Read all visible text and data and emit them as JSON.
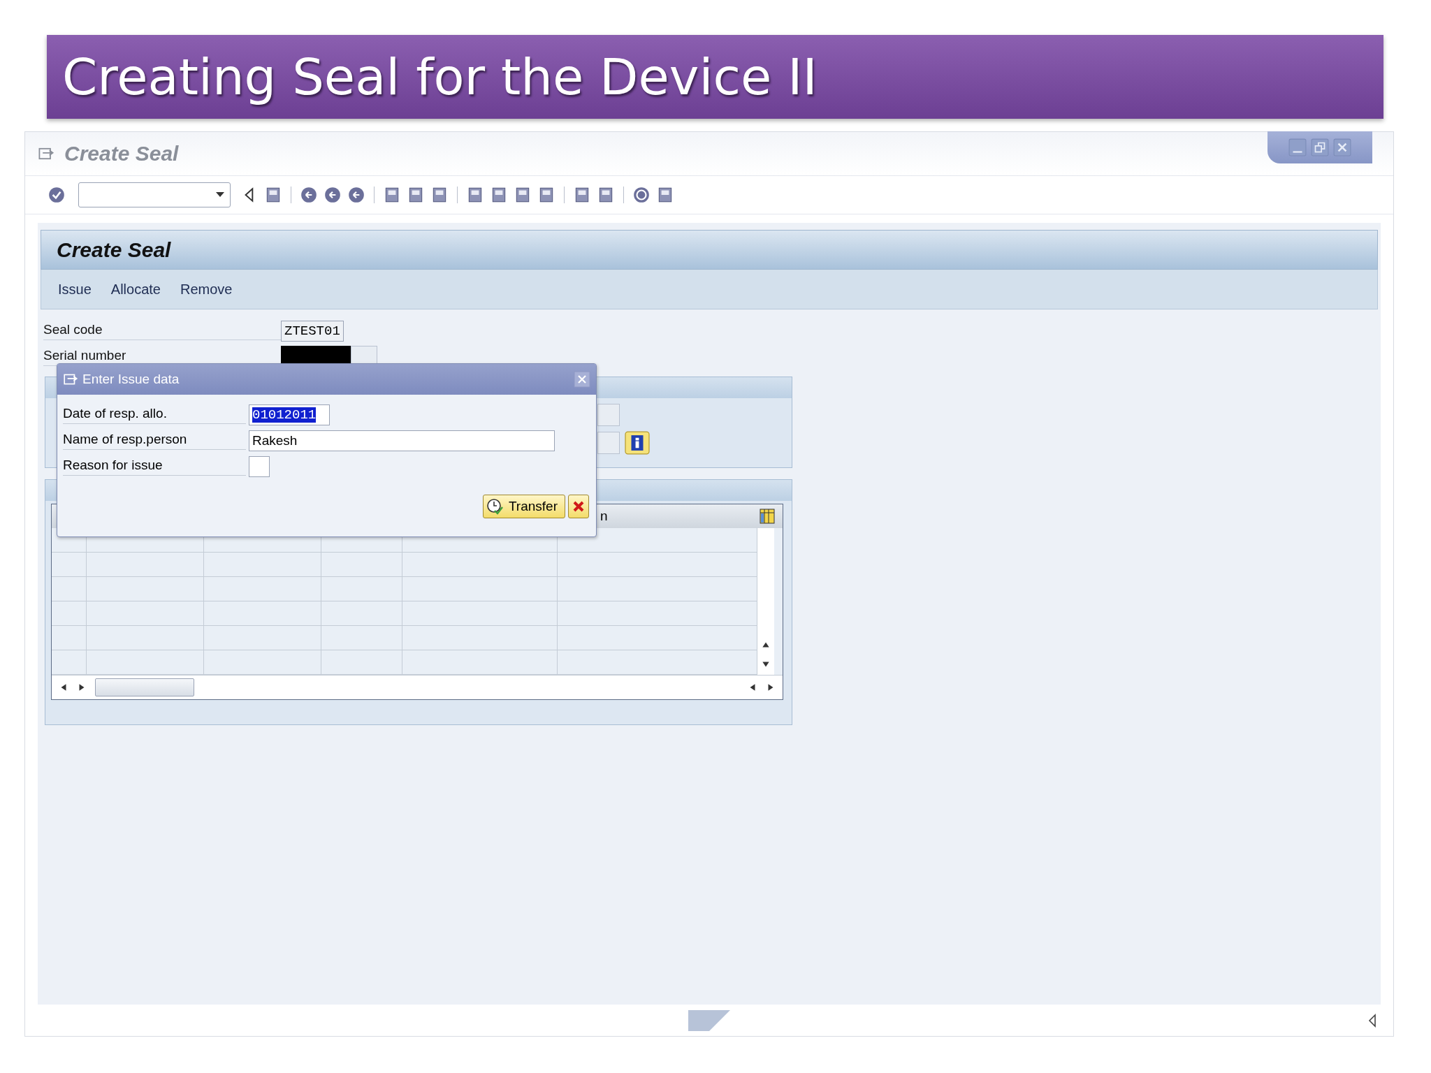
{
  "slide": {
    "title": "Creating Seal for the Device II"
  },
  "window": {
    "title": "Create Seal"
  },
  "screen": {
    "title": "Create Seal",
    "menu": [
      "Issue",
      "Allocate",
      "Remove"
    ],
    "fields": [
      {
        "label": "Seal code",
        "value": "ZTEST01"
      },
      {
        "label": "Serial number",
        "redacted": true
      }
    ],
    "table": {
      "column_6_header": "n"
    }
  },
  "dialog": {
    "title": "Enter Issue data",
    "fields": [
      {
        "label": "Date of resp. allo.",
        "value": "01012011",
        "text_selected": true,
        "kind": "short"
      },
      {
        "label": "Name of resp.person",
        "value": "Rakesh",
        "text_selected": false,
        "kind": "long"
      },
      {
        "label": "Reason for issue",
        "kind": "box"
      }
    ],
    "buttons": [
      {
        "label": "Transfer",
        "kind": "transfer"
      },
      {
        "kind": "cancel"
      }
    ]
  }
}
